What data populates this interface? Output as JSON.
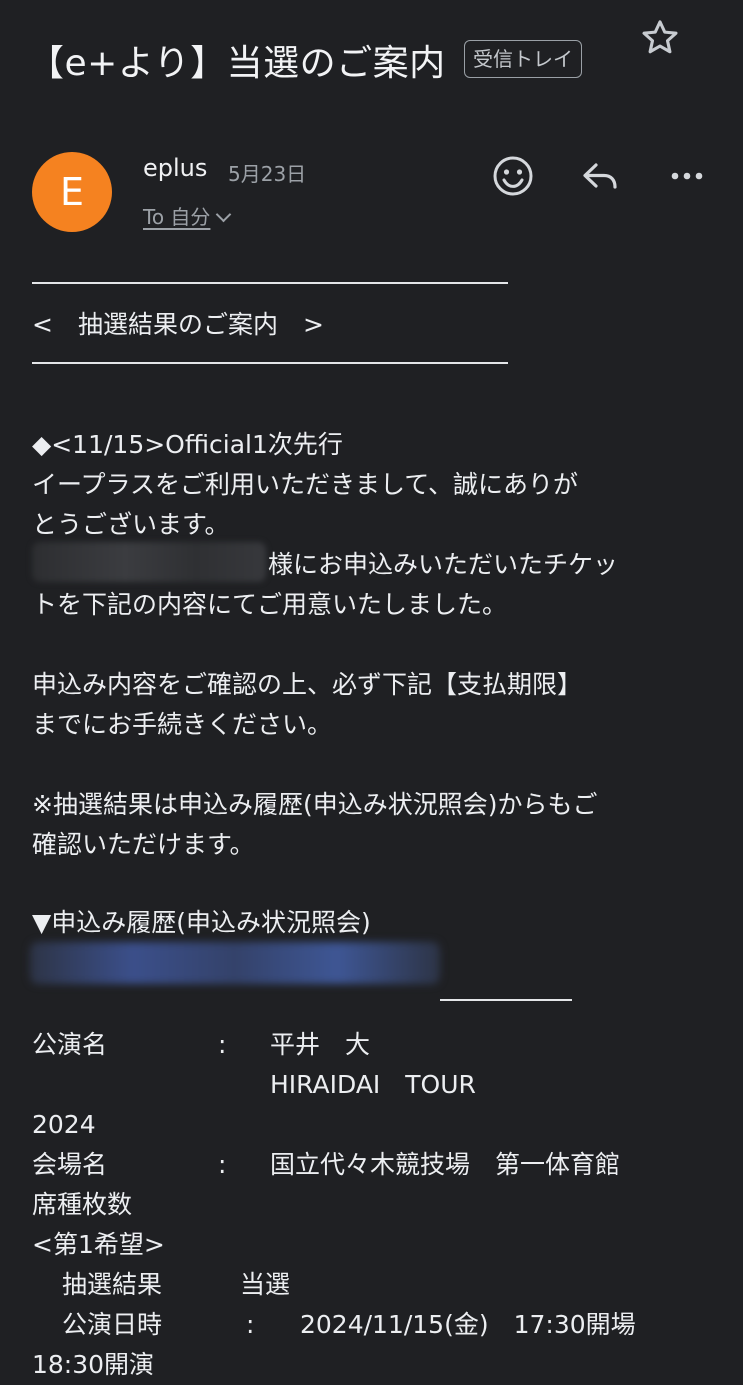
{
  "header": {
    "subject": "【e+より】当選のご案内",
    "label": "受信トレイ"
  },
  "sender": {
    "avatar_letter": "E",
    "avatar_color": "#f58220",
    "name": "eplus",
    "date": "5月23日",
    "to_label": "To 自分"
  },
  "actions": {
    "reaction_icon": "smiley-icon",
    "reply_icon": "reply-icon",
    "more_icon": "more-icon",
    "star_icon": "star-icon"
  },
  "body": {
    "banner_title": "<　抽選結果のご案内　>",
    "event_line": "◆<11/15>Official1次先行",
    "intro_1": "イープラスをご利用いただきまして、誠にありが",
    "intro_2": "とうございます。",
    "applicant_suffix": "様にお申込みいただいたチケッ",
    "ticket_line": "トを下記の内容にてご用意いたしました。",
    "confirm_1": "申込み内容をご確認の上、必ず下記【支払期限】",
    "confirm_2": "までにお手続きください。",
    "note_1": "※抽選結果は申込み履歴(申込み状況照会)からもご",
    "note_2": "確認いただけます。",
    "history_label": "▼申込み履歴(申込み状況照会)"
  },
  "details": {
    "performance_label": "公演名",
    "separator": ":",
    "performance_name_1": "平井　大",
    "performance_name_2": "HIRAIDAI　TOUR",
    "performance_name_3": "2024",
    "venue_label": "会場名",
    "venue_name": "国立代々木競技場　第一体育館",
    "seat_label": "席種枚数",
    "choice_label": "<第1希望>",
    "result_label": "抽選結果",
    "result_value": "当選",
    "datetime_label": "公演日時",
    "datetime_value": "2024/11/15(金)　17:30開場",
    "datetime_value_2": "18:30開演"
  }
}
